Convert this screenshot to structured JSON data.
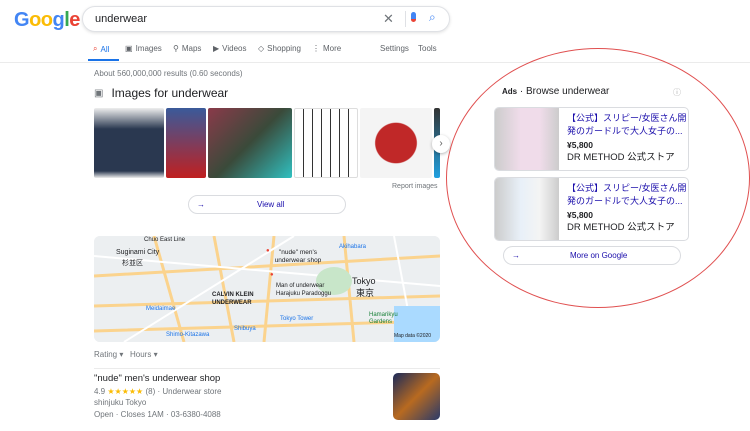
{
  "logo": "Google",
  "search": {
    "value": "underwear"
  },
  "tabs": [
    {
      "label": "All",
      "icon": "search-icon"
    },
    {
      "label": "Images",
      "icon": "image-icon"
    },
    {
      "label": "Maps",
      "icon": "pin-icon"
    },
    {
      "label": "Videos",
      "icon": "play-icon"
    },
    {
      "label": "Shopping",
      "icon": "tag-icon"
    },
    {
      "label": "More",
      "icon": "dots-icon"
    }
  ],
  "settings": "Settings",
  "tools": "Tools",
  "stats": "About 560,000,000 results (0.60 seconds)",
  "images": {
    "heading": "Images for underwear",
    "report": "Report images",
    "view_all": "View all"
  },
  "map": {
    "labels": [
      "Chuo East Line",
      "Suginami City",
      "杉並区",
      "\"nude\" men's underwear shop",
      "Man of underwear Harajuku Paradoggu",
      "CALVIN KLEIN UNDERWEAR",
      "Tokyo",
      "東京",
      "Meidaimae",
      "Shibuya",
      "Shimo-Kitazawa",
      "Tokyo Tower",
      "Hamarikyu Gardens",
      "Akihabara"
    ],
    "credit": "Map data ©2020"
  },
  "filters": [
    "Rating",
    "Hours"
  ],
  "listing": {
    "name": "\"nude\" men's underwear shop",
    "rating": "4.9",
    "stars": "★★★★★",
    "reviews": "(8)",
    "category": "Underwear store",
    "address": "shinjuku Tokyo",
    "hours": "Open · Closes 1AM · 03-6380-4088"
  },
  "ads": {
    "label": "Ads",
    "title": "Browse underwear",
    "items": [
      {
        "title": "【公式】スリピー/女医さん開発のガードルで大人女子の...",
        "price": "¥5,800",
        "seller": "DR METHOD 公式ストア",
        "color": "#e8b8d8"
      },
      {
        "title": "【公式】スリピー/女医さん開発のガードルで大人女子の...",
        "price": "¥5,800",
        "seller": "DR METHOD 公式ストア",
        "color": "#a8c8e8"
      }
    ],
    "more": "More on Google"
  }
}
